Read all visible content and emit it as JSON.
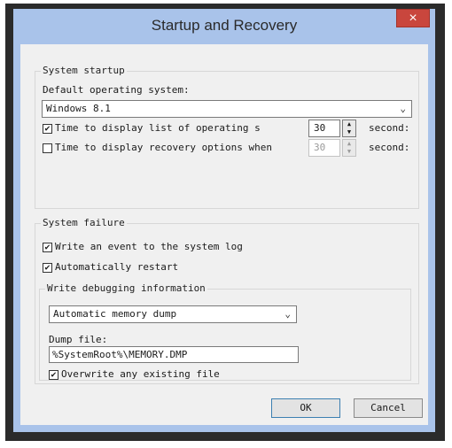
{
  "dialog": {
    "title": "Startup and Recovery",
    "close_symbol": "×"
  },
  "system_startup": {
    "legend": "System startup",
    "default_os_label": "Default operating system:",
    "default_os_value": "Windows 8.1",
    "time_list_checked": true,
    "time_list_label": "Time to display list of operating s",
    "time_list_value": "30",
    "time_list_unit": "second:",
    "time_recovery_checked": false,
    "time_recovery_label": "Time to display recovery options when",
    "time_recovery_value": "30",
    "time_recovery_unit": "second:"
  },
  "system_failure": {
    "legend": "System failure",
    "write_event_checked": true,
    "write_event_label": "Write an event to the system log",
    "auto_restart_checked": true,
    "auto_restart_label": "Automatically restart",
    "debug_legend": "Write debugging information",
    "debug_type_value": "Automatic memory dump",
    "dump_file_label": "Dump file:",
    "dump_file_value": "%SystemRoot%\\MEMORY.DMP",
    "overwrite_checked": true,
    "overwrite_label": "Overwrite any existing file"
  },
  "buttons": {
    "ok_label": "OK",
    "cancel_label": "Cancel"
  },
  "icons": {
    "checkmark": "✔",
    "chevron_down": "⌄",
    "spin_up": "▲",
    "spin_down": "▼"
  },
  "colors": {
    "titlebar": "#a9c3ea",
    "close_button": "#c9463d",
    "client_bg": "#f0f0f0"
  }
}
